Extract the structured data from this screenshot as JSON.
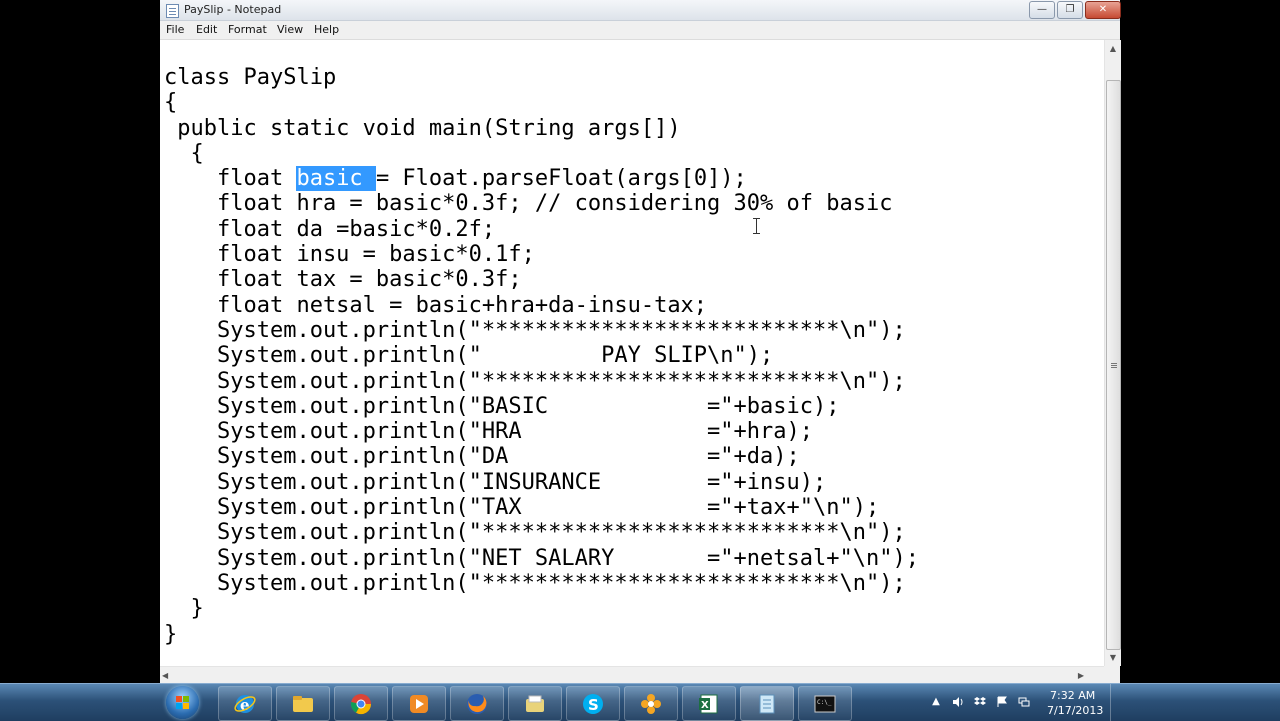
{
  "window": {
    "title": "PaySlip - Notepad",
    "minimize_glyph": "—",
    "maximize_glyph": "❐",
    "close_glyph": "✕"
  },
  "menu": {
    "file": "File",
    "edit": "Edit",
    "format": "Format",
    "view": "View",
    "help": "Help"
  },
  "editor": {
    "selected_text": "basic ",
    "lines": [
      "class PaySlip",
      "{",
      " public static void main(String args[])",
      "  {",
      "    float ",
      "    float hra = basic*0.3f; // considering 30% of basic",
      "    float da =basic*0.2f;",
      "    float insu = basic*0.1f;",
      "    float tax = basic*0.3f;",
      "    float netsal = basic+hra+da-insu-tax;",
      "    System.out.println(\"***************************\\n\");",
      "    System.out.println(\"         PAY SLIP\\n\");",
      "    System.out.println(\"***************************\\n\");",
      "    System.out.println(\"BASIC            =\"+basic);",
      "    System.out.println(\"HRA              =\"+hra);",
      "    System.out.println(\"DA               =\"+da);",
      "    System.out.println(\"INSURANCE        =\"+insu);",
      "    System.out.println(\"TAX              =\"+tax+\"\\n\");",
      "    System.out.println(\"***************************\\n\");",
      "    System.out.println(\"NET SALARY       =\"+netsal+\"\\n\");",
      "    System.out.println(\"***************************\\n\");",
      "  }",
      "}"
    ],
    "line5_after_selection": "= Float.parseFloat(args[0]);"
  },
  "scrollbar": {
    "up_glyph": "▲",
    "down_glyph": "▼",
    "left_glyph": "◀",
    "right_glyph": "▶"
  },
  "taskbar": {
    "apps": [
      "internet-explorer",
      "file-explorer",
      "chrome",
      "media-player",
      "firefox",
      "folder",
      "skype",
      "app-orange",
      "excel",
      "notepad",
      "command-prompt"
    ],
    "tray_arrow": "▲",
    "clock": {
      "time": "7:32 AM",
      "date": "7/17/2013"
    }
  },
  "colors": {
    "selection": "#3399ff",
    "taskbar": "#2c5178"
  }
}
